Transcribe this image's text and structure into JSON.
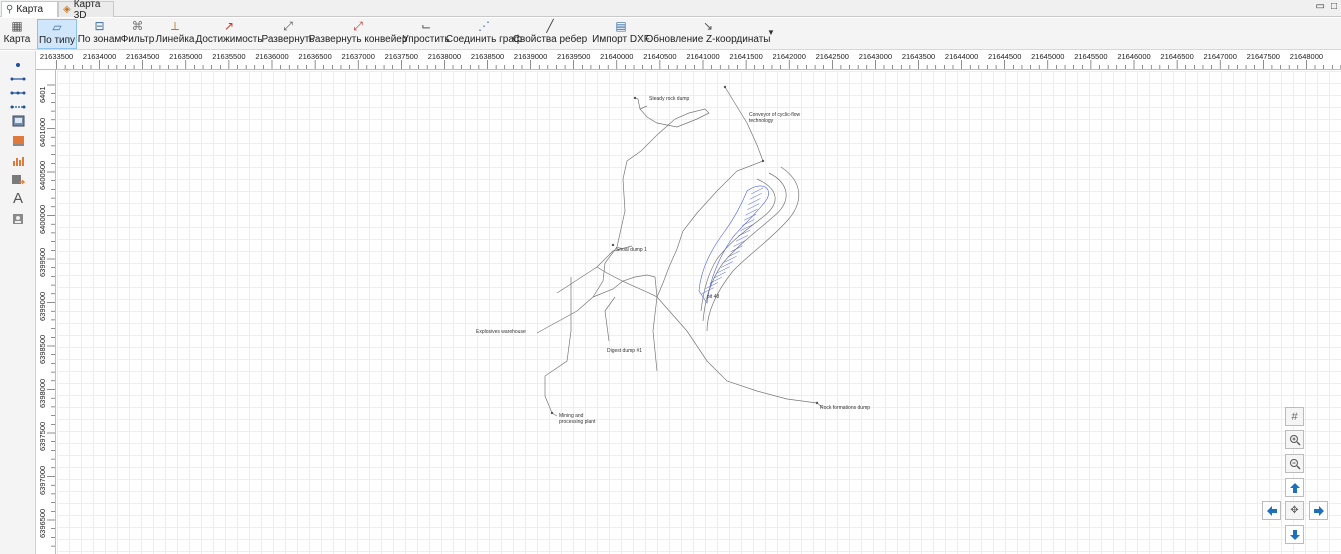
{
  "tabs": [
    {
      "label": "Карта",
      "icon": "map-icon",
      "active": true
    },
    {
      "label": "Карта 3D",
      "icon": "map-3d-icon",
      "active": false
    }
  ],
  "window_controls": [
    "minimize-icon",
    "maximize-icon"
  ],
  "toolbar": {
    "items": [
      {
        "label": "Карта",
        "icon": "map-icon"
      },
      {
        "label": "По типу",
        "icon": "by-type-icon",
        "selected": true
      },
      {
        "label": "По зонам",
        "icon": "by-zones-icon"
      },
      {
        "label": "Фильтр",
        "icon": "filter-icon"
      },
      {
        "label": "Линейка",
        "icon": "ruler-icon"
      },
      {
        "label": "Достижимость",
        "icon": "reachability-icon"
      },
      {
        "label": "Развернуть",
        "icon": "expand-icon"
      },
      {
        "label": "Развернуть конвейер",
        "icon": "expand-conveyor-icon"
      },
      {
        "label": "Упростить",
        "icon": "simplify-icon"
      },
      {
        "label": "Соединить граф",
        "icon": "connect-graph-icon"
      },
      {
        "label": "Свойства ребер",
        "icon": "edge-properties-icon"
      },
      {
        "label": "Импорт DXF",
        "icon": "import-dxf-icon"
      },
      {
        "label": "Обновление Z-координаты",
        "icon": "update-z-icon"
      }
    ],
    "more_icon": "chevron-down-icon"
  },
  "left_tools": [
    "point-icon",
    "line-icon",
    "polyline-icon",
    "polyline-nodes-icon",
    "image-frame-icon",
    "layer-icon",
    "chart-icon",
    "export-icon",
    "text-icon",
    "portrait-icon"
  ],
  "left_tool_text": {
    "text_tool": "A"
  },
  "ruler": {
    "x_labels": [
      "21633500",
      "21634000",
      "21634500",
      "21635000",
      "21635500",
      "21636000",
      "21636500",
      "21637000",
      "21637500",
      "21638000",
      "21638500",
      "21639000",
      "21639500",
      "21640000",
      "21640500",
      "21641000",
      "21641500",
      "21642000",
      "21642500",
      "21643000",
      "21643500",
      "21644000",
      "21644500",
      "21645000",
      "21645500",
      "21646000",
      "21646500",
      "21647000",
      "21647500",
      "21648000"
    ],
    "y_labels": [
      "6401",
      "6401000",
      "6400500",
      "6400000",
      "6399500",
      "6399000",
      "6398500",
      "6398000",
      "6397500",
      "6397000",
      "6396500"
    ]
  },
  "map_labels": [
    "Steady rock dump",
    "Conveyor of cyclic-flow technology",
    "Shoal dump 1",
    "pit 48",
    "Explosives warehouse",
    "Digest dump #1",
    "Mining and processing plant",
    "Rock formations dump"
  ],
  "nav_controls": [
    "grid-icon",
    "zoom-in-icon",
    "zoom-out-icon",
    "pan-up-icon",
    "pan-left-icon",
    "pan-center-icon",
    "pan-right-icon",
    "pan-down-icon"
  ],
  "colors": {
    "selected_tool_bg": "#cfe6fb",
    "nav_arrow": "#1f6fbf",
    "pit_hatch": "#4a5ee8",
    "map_line": "#777777"
  }
}
